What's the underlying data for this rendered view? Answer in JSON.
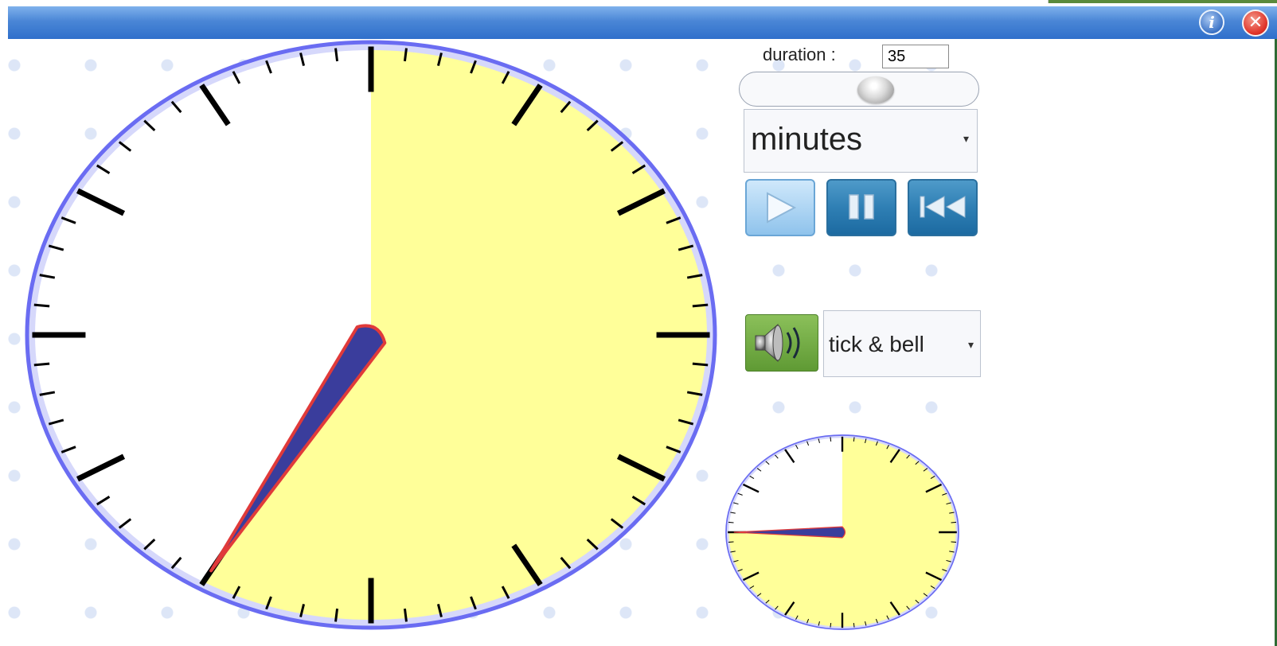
{
  "window": {
    "info_glyph": "i",
    "close_glyph": "✕",
    "colors": {
      "titlebar": "#3b7bd3",
      "close": "#e0352a",
      "info": "#3c73c6"
    }
  },
  "timer": {
    "duration_label": "duration :",
    "duration_value": "35",
    "slider_fraction": 0.58,
    "unit_selected": "minutes",
    "buttons": {
      "play_icon": "play-icon",
      "pause_icon": "pause-icon",
      "reset_icon": "skip-to-start-icon"
    },
    "sound_icon": "speaker-icon",
    "sound_selected": "tick & bell"
  },
  "clocks": {
    "big": {
      "sector_minutes": 35,
      "hand_minute": 35,
      "ticks_per_revolution": 60,
      "major_every": 5
    },
    "small": {
      "sector_minutes": 45,
      "hand_minute": 45,
      "ticks_per_revolution": 60,
      "major_every": 5
    },
    "colors": {
      "sector": "#ffff99",
      "rim": "#6a6cf2",
      "rim_inner": "#d6d8fb",
      "hand_fill": "#3a3d9c",
      "hand_outline": "#e03a3a"
    }
  }
}
